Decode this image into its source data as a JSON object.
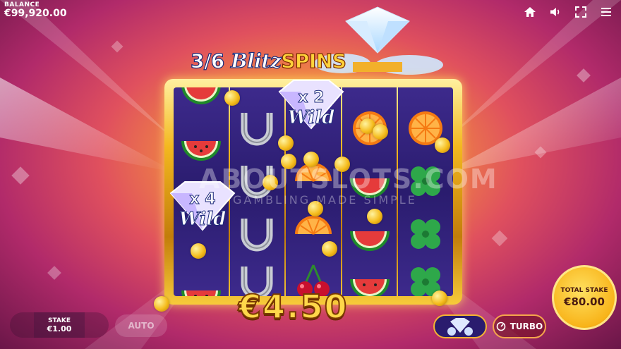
{
  "balance": {
    "label": "BALANCE",
    "value": "€99,920.00"
  },
  "top_icons": [
    "home-icon",
    "speaker-icon",
    "fullscreen-icon",
    "menu-icon"
  ],
  "spins": {
    "count": "3/6",
    "blitz": "Blitz",
    "word": "SPINS"
  },
  "wilds": [
    {
      "multiplier": "x 2",
      "label": "Wild"
    },
    {
      "multiplier": "x 4",
      "label": "Wild"
    }
  ],
  "reels": [
    [
      "watermelon",
      "watermelon",
      "watermelon",
      "wild",
      "watermelon"
    ],
    [
      "horseshoe",
      "horseshoe",
      "horseshoe",
      "horseshoe"
    ],
    [
      "wild",
      "orange",
      "orange",
      "cherries"
    ],
    [
      "orange",
      "watermelon",
      "watermelon",
      "watermelon"
    ],
    [
      "orange",
      "clover",
      "clover",
      "clover"
    ]
  ],
  "watermark": {
    "main": "ABOUTSLOTS.COM",
    "sub": "GAMBLING MADE SIMPLE"
  },
  "win": {
    "amount": "€4.50"
  },
  "stake": {
    "label": "STAKE",
    "value": "€1.00"
  },
  "auto": {
    "label": "AUTO"
  },
  "turbo": {
    "label": "TURBO"
  },
  "total_stake": {
    "label": "TOTAL STAKE",
    "value": "€80.00"
  },
  "colors": {
    "gold": "#f5b531",
    "reel_bg": "#2a1c6e",
    "win_text": "#ffd84a"
  }
}
